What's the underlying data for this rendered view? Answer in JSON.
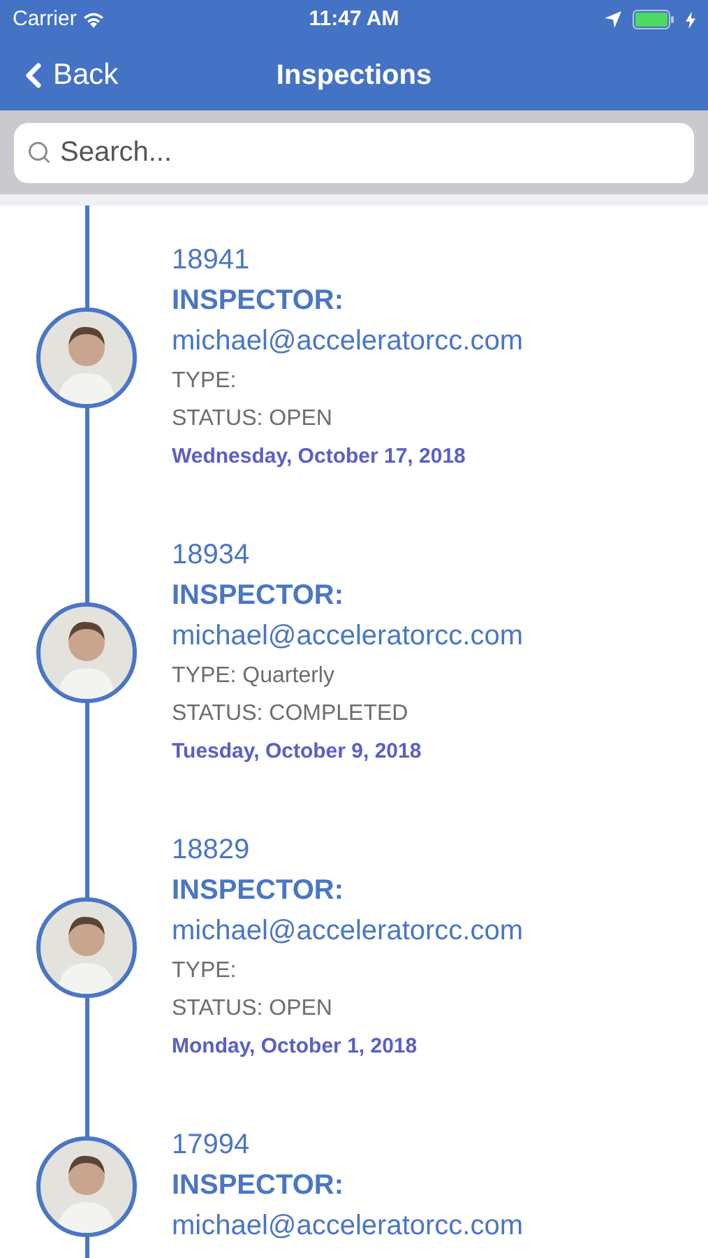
{
  "status_bar": {
    "carrier": "Carrier",
    "time": "11:47 AM"
  },
  "nav": {
    "back": "Back",
    "title": "Inspections"
  },
  "search": {
    "placeholder": "Search..."
  },
  "inspections": [
    {
      "id": "18941",
      "inspector_label": "INSPECTOR:",
      "inspector": "michael@acceleratorcc.com",
      "type": "TYPE:",
      "status": "STATUS: OPEN",
      "date": "Wednesday, October 17, 2018"
    },
    {
      "id": "18934",
      "inspector_label": "INSPECTOR:",
      "inspector": "michael@acceleratorcc.com",
      "type": "TYPE: Quarterly",
      "status": "STATUS: COMPLETED",
      "date": "Tuesday, October 9, 2018"
    },
    {
      "id": "18829",
      "inspector_label": "INSPECTOR:",
      "inspector": "michael@acceleratorcc.com",
      "type": "TYPE:",
      "status": "STATUS: OPEN",
      "date": "Monday, October 1, 2018"
    },
    {
      "id": "17994",
      "inspector_label": "INSPECTOR:",
      "inspector": "michael@acceleratorcc.com"
    }
  ]
}
